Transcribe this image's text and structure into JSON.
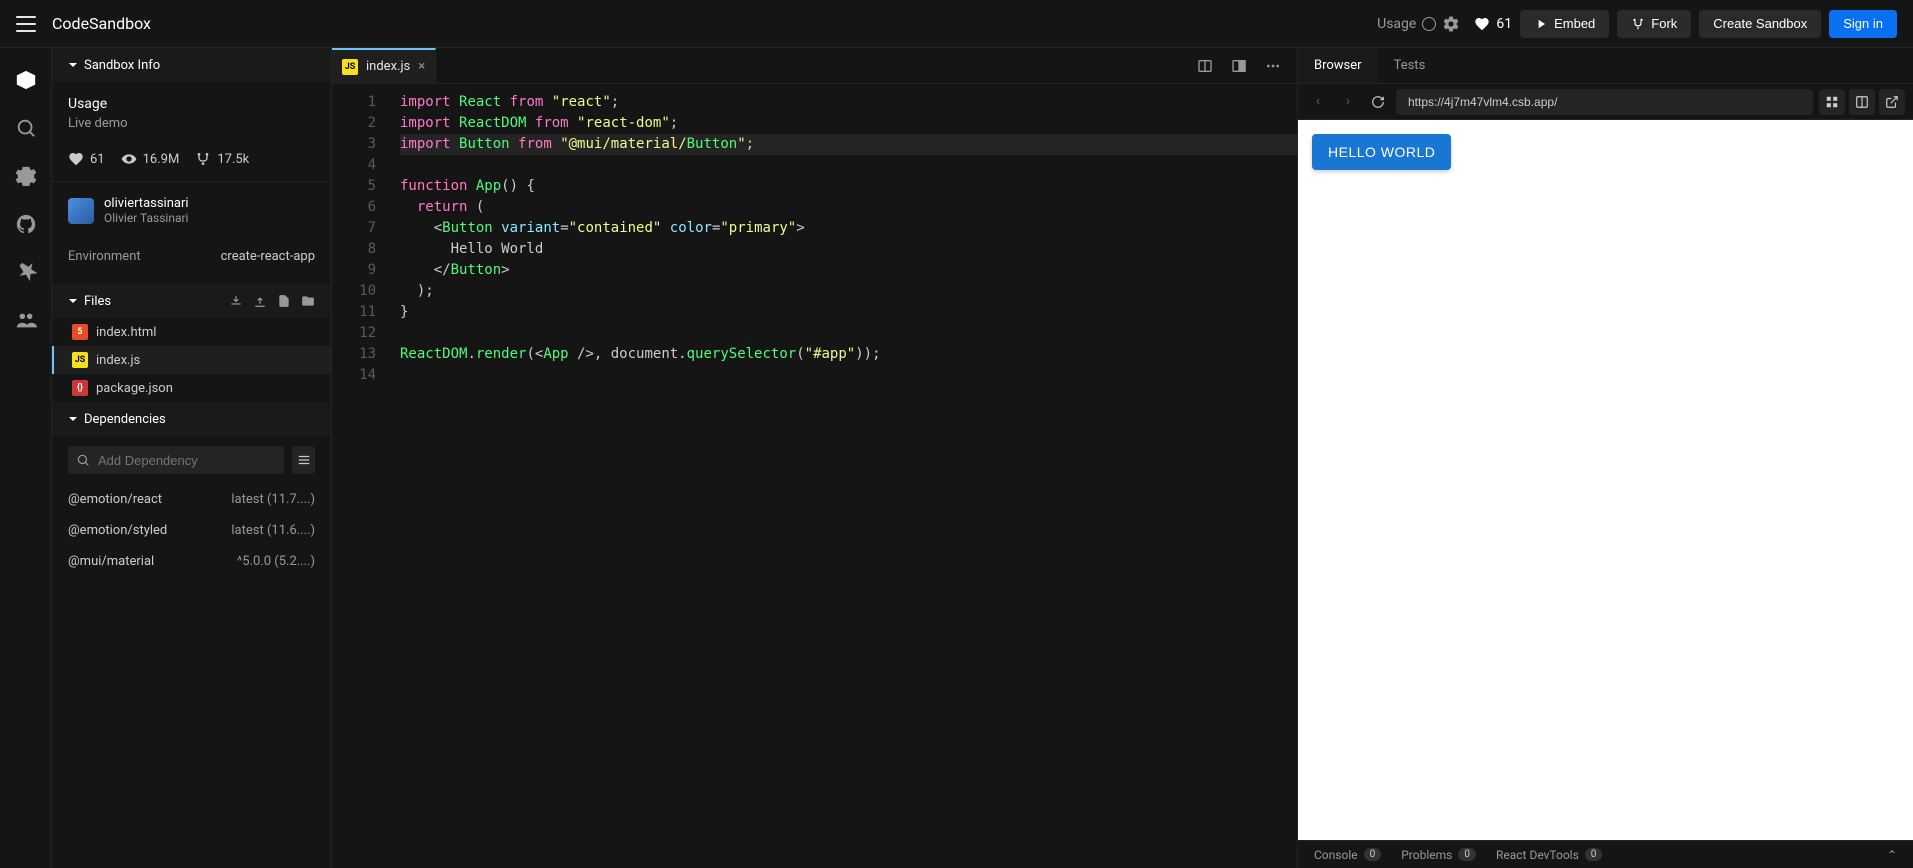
{
  "header": {
    "brand": "CodeSandbox",
    "usage_title": "Usage",
    "likes": "61",
    "embed_label": "Embed",
    "fork_label": "Fork",
    "create_label": "Create Sandbox",
    "signin_label": "Sign in"
  },
  "sidebar": {
    "sandbox_info_title": "Sandbox Info",
    "sandbox_name": "Usage",
    "sandbox_desc": "Live demo",
    "stats": {
      "likes": "61",
      "views": "16.9M",
      "forks": "17.5k"
    },
    "owner": {
      "username": "oliviertassinari",
      "fullname": "Olivier Tassinari"
    },
    "env_label": "Environment",
    "env_value": "create-react-app",
    "files_title": "Files",
    "files": [
      {
        "name": "index.html",
        "type": "html",
        "active": false
      },
      {
        "name": "index.js",
        "type": "js",
        "active": true
      },
      {
        "name": "package.json",
        "type": "json",
        "active": false
      }
    ],
    "deps_title": "Dependencies",
    "dep_search_placeholder": "Add Dependency",
    "deps": [
      {
        "name": "@emotion/react",
        "version": "latest (11.7....)"
      },
      {
        "name": "@emotion/styled",
        "version": "latest (11.6....)"
      },
      {
        "name": "@mui/material",
        "version": "^5.0.0 (5.2....)"
      }
    ]
  },
  "editor": {
    "tab_name": "index.js",
    "lines": [
      "import React from \"react\";",
      "import ReactDOM from \"react-dom\";",
      "import Button from \"@mui/material/Button\";",
      "",
      "function App() {",
      "  return (",
      "    <Button variant=\"contained\" color=\"primary\">",
      "      Hello World",
      "    </Button>",
      "  );",
      "}",
      "",
      "ReactDOM.render(<App />, document.querySelector(\"#app\"));",
      ""
    ]
  },
  "preview": {
    "tabs": {
      "browser": "Browser",
      "tests": "Tests"
    },
    "url": "https://4j7m47vlm4.csb.app/",
    "button_text": "HELLO WORLD",
    "devtools": {
      "console": "Console",
      "console_badge": "0",
      "problems": "Problems",
      "problems_badge": "0",
      "react": "React DevTools",
      "react_badge": "0"
    }
  }
}
